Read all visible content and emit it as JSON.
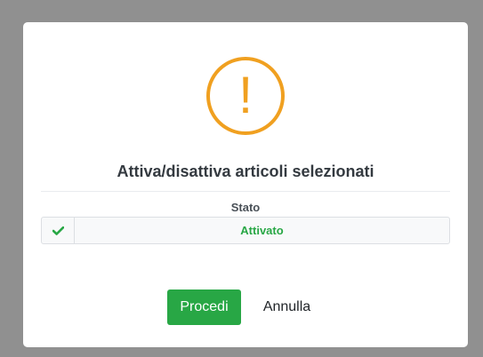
{
  "dialog": {
    "icon": "exclamation-icon",
    "title": "Attiva/disattiva articoli selezionati",
    "field_label": "Stato",
    "state_icon": "check-icon",
    "state_value": "Attivato",
    "confirm_label": "Procedi",
    "cancel_label": "Annulla"
  },
  "colors": {
    "warning": "#f0a020",
    "success": "#28a745",
    "overlay": "#909090"
  }
}
